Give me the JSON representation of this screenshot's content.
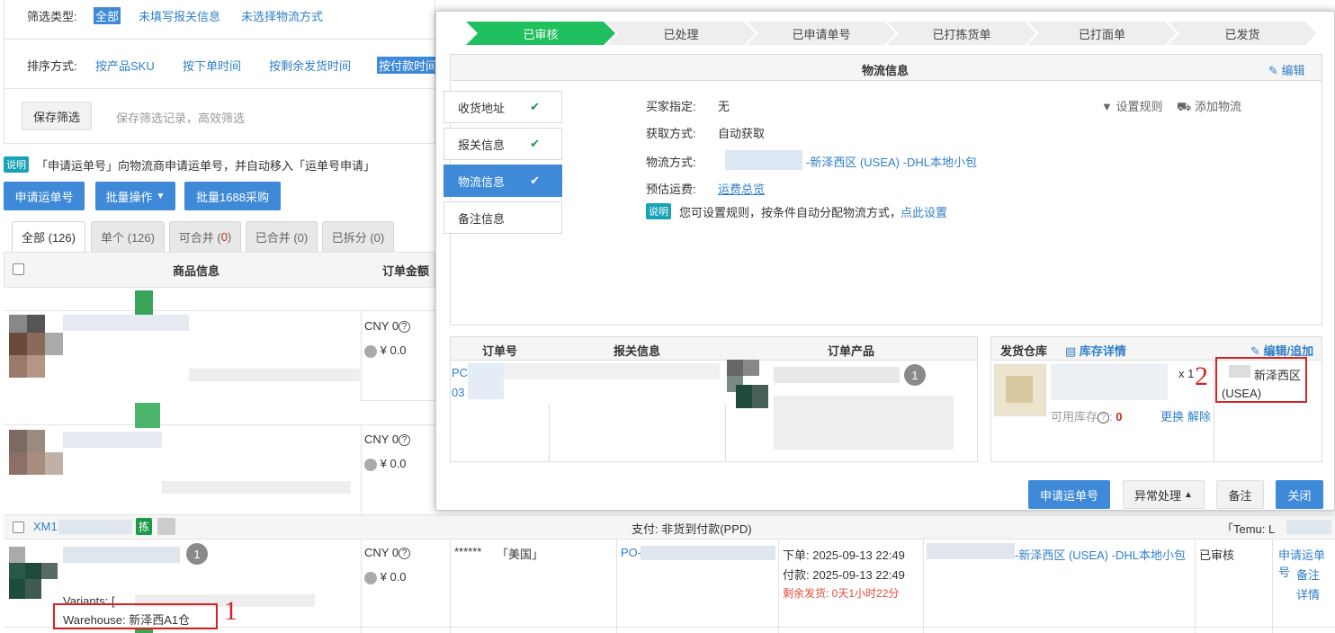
{
  "filter": {
    "type_label": "筛选类型:",
    "type_options": [
      "全部",
      "未填写报关信息",
      "未选择物流方式"
    ],
    "sort_label": "排序方式:",
    "sort_options": [
      "按产品SKU",
      "按下单时间",
      "按剩余发货时间",
      "按付款时间"
    ],
    "save_button": "保存筛选",
    "save_hint": "保存筛选记录，高效筛选"
  },
  "notice": {
    "badge": "说明",
    "text": "「申请运单号」向物流商申请运单号，并自动移入「运单号申请」"
  },
  "actions": {
    "apply_waybill": "申请运单号",
    "batch_ops": "批量操作",
    "batch_1688": "批量1688采购"
  },
  "tabs": [
    {
      "label": "全部 (126)"
    },
    {
      "label": "单个 (126)"
    },
    {
      "label": "可合并 (",
      "count": "0",
      "suffix": ")"
    },
    {
      "label": "已合并 (0)"
    },
    {
      "label": "已拆分 (0)"
    }
  ],
  "table": {
    "col_product": "商品信息",
    "col_amount": "订单金额",
    "rows": [
      {
        "currency": "CNY 0",
        "amount": "¥ 0.0"
      },
      {
        "currency": "CNY 0",
        "amount": "¥ 0.0"
      }
    ],
    "order_row": {
      "order_no": "XM1",
      "tag": "拣",
      "payment": "支付: 非货到付款(PPD)",
      "store": "「Temu: L",
      "qty_badge": "1",
      "variants": "Variants: [",
      "warehouse": "Warehouse: 新泽西A1仓",
      "currency": "CNY 0",
      "amount": "¥ 0.0",
      "buyer": "******",
      "country": "「美国」",
      "po": "PO-",
      "order_time": "下单: 2025-09-13 22:49",
      "pay_time": "付款: 2025-09-13 22:49",
      "remaining": "剩余发货: 0天1小时22分",
      "logistics": "-新泽西区 (USEA) -DHL本地小包",
      "status": "已审核",
      "op_apply": "申请运单号",
      "op_note": "备注",
      "op_detail": "详情"
    }
  },
  "modal": {
    "steps": [
      "已审核",
      "已处理",
      "已申请单号",
      "已打拣货单",
      "已打面单",
      "已发货"
    ],
    "section_title": "物流信息",
    "edit_link": "编辑",
    "side_items": [
      "收货地址",
      "报关信息",
      "物流信息",
      "备注信息"
    ],
    "buyer_label": "买家指定:",
    "buyer_value": "无",
    "fetch_label": "获取方式:",
    "fetch_value": "自动获取",
    "method_label": "物流方式:",
    "method_value": "-新泽西区 (USEA) -DHL本地小包",
    "fee_label": "预估运费:",
    "fee_value": "运费总览",
    "tip_badge": "说明",
    "tip_text": "您可设置规则，按条件自动分配物流方式，",
    "tip_link": "点此设置",
    "set_rule": "设置规则",
    "add_logistics": "添加物流",
    "order_no_col": "订单号",
    "customs_col": "报关信息",
    "product_col": "订单产品",
    "po_prefix": "PC",
    "po_suffix": "03",
    "product_qty": "1",
    "warehouse_col": "发货仓库",
    "stock_detail": "库存详情",
    "edit_append": "编辑/追加",
    "qty": "x 1",
    "stock_label": "可用库存",
    "stock_value": "0",
    "replace": "更换",
    "unbind": "解除",
    "warehouse_region": "新泽西区",
    "warehouse_code": "(USEA)",
    "btn_apply": "申请运单号",
    "btn_exception": "异常处理",
    "btn_note": "备注",
    "btn_close": "关闭"
  },
  "annotations": {
    "one": "1",
    "two": "2"
  },
  "colors": {
    "accent": "#3e8ad8",
    "green": "#1fc05d",
    "red": "#d42323",
    "teal": "#18a2b8"
  }
}
